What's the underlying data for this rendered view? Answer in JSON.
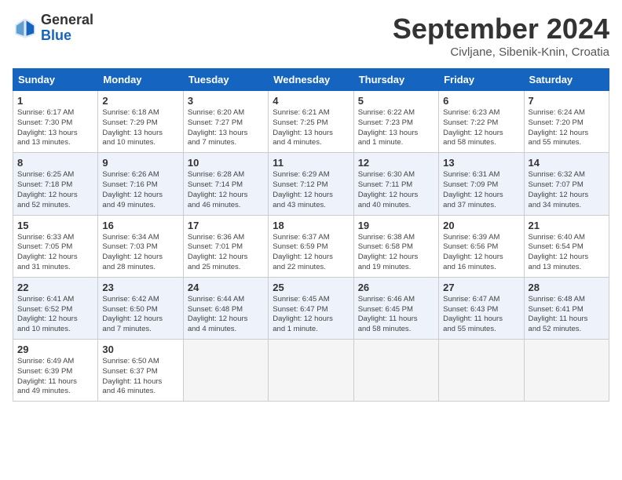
{
  "logo": {
    "general": "General",
    "blue": "Blue"
  },
  "title": "September 2024",
  "location": "Civljane, Sibenik-Knin, Croatia",
  "days_of_week": [
    "Sunday",
    "Monday",
    "Tuesday",
    "Wednesday",
    "Thursday",
    "Friday",
    "Saturday"
  ],
  "weeks": [
    [
      {
        "day": "1",
        "info": "Sunrise: 6:17 AM\nSunset: 7:30 PM\nDaylight: 13 hours\nand 13 minutes."
      },
      {
        "day": "2",
        "info": "Sunrise: 6:18 AM\nSunset: 7:29 PM\nDaylight: 13 hours\nand 10 minutes."
      },
      {
        "day": "3",
        "info": "Sunrise: 6:20 AM\nSunset: 7:27 PM\nDaylight: 13 hours\nand 7 minutes."
      },
      {
        "day": "4",
        "info": "Sunrise: 6:21 AM\nSunset: 7:25 PM\nDaylight: 13 hours\nand 4 minutes."
      },
      {
        "day": "5",
        "info": "Sunrise: 6:22 AM\nSunset: 7:23 PM\nDaylight: 13 hours\nand 1 minute."
      },
      {
        "day": "6",
        "info": "Sunrise: 6:23 AM\nSunset: 7:22 PM\nDaylight: 12 hours\nand 58 minutes."
      },
      {
        "day": "7",
        "info": "Sunrise: 6:24 AM\nSunset: 7:20 PM\nDaylight: 12 hours\nand 55 minutes."
      }
    ],
    [
      {
        "day": "8",
        "info": "Sunrise: 6:25 AM\nSunset: 7:18 PM\nDaylight: 12 hours\nand 52 minutes."
      },
      {
        "day": "9",
        "info": "Sunrise: 6:26 AM\nSunset: 7:16 PM\nDaylight: 12 hours\nand 49 minutes."
      },
      {
        "day": "10",
        "info": "Sunrise: 6:28 AM\nSunset: 7:14 PM\nDaylight: 12 hours\nand 46 minutes."
      },
      {
        "day": "11",
        "info": "Sunrise: 6:29 AM\nSunset: 7:12 PM\nDaylight: 12 hours\nand 43 minutes."
      },
      {
        "day": "12",
        "info": "Sunrise: 6:30 AM\nSunset: 7:11 PM\nDaylight: 12 hours\nand 40 minutes."
      },
      {
        "day": "13",
        "info": "Sunrise: 6:31 AM\nSunset: 7:09 PM\nDaylight: 12 hours\nand 37 minutes."
      },
      {
        "day": "14",
        "info": "Sunrise: 6:32 AM\nSunset: 7:07 PM\nDaylight: 12 hours\nand 34 minutes."
      }
    ],
    [
      {
        "day": "15",
        "info": "Sunrise: 6:33 AM\nSunset: 7:05 PM\nDaylight: 12 hours\nand 31 minutes."
      },
      {
        "day": "16",
        "info": "Sunrise: 6:34 AM\nSunset: 7:03 PM\nDaylight: 12 hours\nand 28 minutes."
      },
      {
        "day": "17",
        "info": "Sunrise: 6:36 AM\nSunset: 7:01 PM\nDaylight: 12 hours\nand 25 minutes."
      },
      {
        "day": "18",
        "info": "Sunrise: 6:37 AM\nSunset: 6:59 PM\nDaylight: 12 hours\nand 22 minutes."
      },
      {
        "day": "19",
        "info": "Sunrise: 6:38 AM\nSunset: 6:58 PM\nDaylight: 12 hours\nand 19 minutes."
      },
      {
        "day": "20",
        "info": "Sunrise: 6:39 AM\nSunset: 6:56 PM\nDaylight: 12 hours\nand 16 minutes."
      },
      {
        "day": "21",
        "info": "Sunrise: 6:40 AM\nSunset: 6:54 PM\nDaylight: 12 hours\nand 13 minutes."
      }
    ],
    [
      {
        "day": "22",
        "info": "Sunrise: 6:41 AM\nSunset: 6:52 PM\nDaylight: 12 hours\nand 10 minutes."
      },
      {
        "day": "23",
        "info": "Sunrise: 6:42 AM\nSunset: 6:50 PM\nDaylight: 12 hours\nand 7 minutes."
      },
      {
        "day": "24",
        "info": "Sunrise: 6:44 AM\nSunset: 6:48 PM\nDaylight: 12 hours\nand 4 minutes."
      },
      {
        "day": "25",
        "info": "Sunrise: 6:45 AM\nSunset: 6:47 PM\nDaylight: 12 hours\nand 1 minute."
      },
      {
        "day": "26",
        "info": "Sunrise: 6:46 AM\nSunset: 6:45 PM\nDaylight: 11 hours\nand 58 minutes."
      },
      {
        "day": "27",
        "info": "Sunrise: 6:47 AM\nSunset: 6:43 PM\nDaylight: 11 hours\nand 55 minutes."
      },
      {
        "day": "28",
        "info": "Sunrise: 6:48 AM\nSunset: 6:41 PM\nDaylight: 11 hours\nand 52 minutes."
      }
    ],
    [
      {
        "day": "29",
        "info": "Sunrise: 6:49 AM\nSunset: 6:39 PM\nDaylight: 11 hours\nand 49 minutes."
      },
      {
        "day": "30",
        "info": "Sunrise: 6:50 AM\nSunset: 6:37 PM\nDaylight: 11 hours\nand 46 minutes."
      },
      {
        "day": "",
        "info": ""
      },
      {
        "day": "",
        "info": ""
      },
      {
        "day": "",
        "info": ""
      },
      {
        "day": "",
        "info": ""
      },
      {
        "day": "",
        "info": ""
      }
    ]
  ]
}
